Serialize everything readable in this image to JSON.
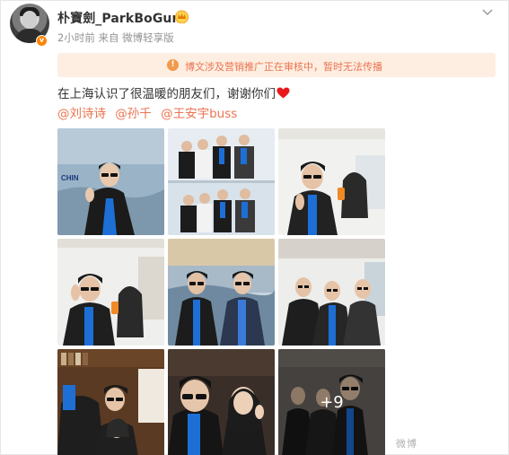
{
  "post": {
    "username": "朴寶劍_ParkBoGum",
    "meta": "2小时前 来自 微博轻享版",
    "notice": "博文涉及营销推广正在审核中，暂时无法传播",
    "content": "在上海认识了很温暖的朋友们，谢谢你们",
    "mentions": [
      "@刘诗诗",
      "@孙千",
      "@王安宇buss"
    ],
    "more_count": "+9",
    "watermark": "微博"
  },
  "photos": [
    {
      "name": "photo-1-beach-painting-sunglasses",
      "sign": "CHIN"
    },
    {
      "name": "photo-2-group-mirror"
    },
    {
      "name": "photo-3-selfie-with-phone"
    },
    {
      "name": "photo-4-selfie-peace-sign"
    },
    {
      "name": "photo-5-two-men-sunglasses"
    },
    {
      "name": "photo-6-mirror-peace-signs"
    },
    {
      "name": "photo-7-bookshelf-selfie"
    },
    {
      "name": "photo-8-close-selfie"
    },
    {
      "name": "photo-9-more-photos"
    }
  ],
  "colors": {
    "accent": "#eb7350",
    "notice_bg": "#fdeee1",
    "badge": "#ff8200",
    "text": "#333333",
    "meta": "#939393"
  },
  "icons": {
    "avatar_badge": "orange-v-badge",
    "crown": "crown-icon",
    "chevron": "chevron-down-icon",
    "notice": "info-icon",
    "heart": "red-heart-icon"
  }
}
